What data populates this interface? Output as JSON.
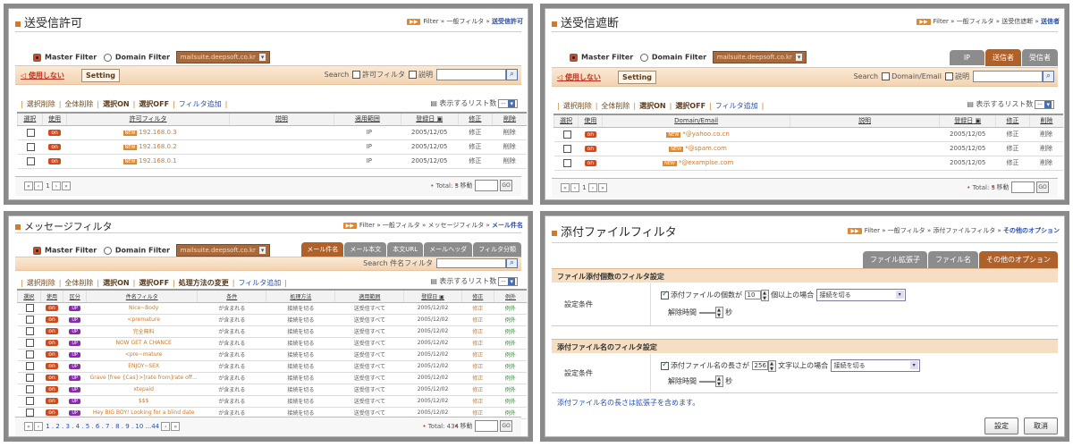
{
  "p1": {
    "title": "送受信許可",
    "crumb": {
      "badge": "Filter",
      "a": "Filter",
      "b": "一般フィルタ",
      "cur": "送受信許可"
    },
    "master": "Master Filter",
    "domain": "Domain Filter",
    "domain_value": "mailsuite.deepsoft.co.kr",
    "use": "使用しない",
    "setting": "Setting",
    "search": "Search",
    "search_cb1": "許可フィルタ",
    "search_cb2": "説明",
    "act": {
      "a": "選択削除",
      "b": "全体削除",
      "c": "選択ON",
      "d": "選択OFF",
      "e": "フィルタ追加"
    },
    "listcnt": "表示するリスト数",
    "listsel": "--",
    "cols": [
      "選択",
      "使用",
      "許可フィルタ",
      "説明",
      "適用範囲",
      "登録日",
      "修正",
      "削除"
    ],
    "rows": [
      {
        "on": "on",
        "new": "NEW",
        "val": "192.168.0.3",
        "desc": "",
        "scope": "IP",
        "date": "2005/12/05",
        "edit": "修正",
        "del": "削除"
      },
      {
        "on": "on",
        "new": "NEW",
        "val": "192.168.0.2",
        "desc": "",
        "scope": "IP",
        "date": "2005/12/05",
        "edit": "修正",
        "del": "削除"
      },
      {
        "on": "on",
        "new": "NEW",
        "val": "192.168.0.1",
        "desc": "",
        "scope": "IP",
        "date": "2005/12/05",
        "edit": "修正",
        "del": "削除"
      }
    ],
    "page": "1",
    "total": "Total: 3",
    "move": "移動",
    "go": "GO"
  },
  "p2": {
    "title": "送受信遮断",
    "crumb": {
      "badge": "Filter",
      "a": "Filter",
      "b": "一般フィルタ",
      "c": "送受信遮断",
      "cur": "送信者"
    },
    "master": "Master Filter",
    "domain": "Domain Filter",
    "domain_value": "mailsuite.deepsoft.co.kr",
    "tabs": [
      "IP",
      "送信者",
      "受信者"
    ],
    "use": "使用しない",
    "setting": "Setting",
    "search": "Search",
    "search_cb1": "Domain/Email",
    "search_cb2": "説明",
    "act": {
      "a": "選択削除",
      "b": "全体削除",
      "c": "選択ON",
      "d": "選択OFF",
      "e": "フィルタ追加"
    },
    "listcnt": "表示するリスト数",
    "listsel": "--",
    "cols": [
      "選択",
      "使用",
      "Domain/Email",
      "説明",
      "登録日",
      "修正",
      "削除"
    ],
    "rows": [
      {
        "on": "on",
        "new": "NEW",
        "val": "*@yahoo.co.cn",
        "date": "2005/12/05",
        "edit": "修正",
        "del": "削除"
      },
      {
        "on": "on",
        "new": "NEW",
        "val": "*@spam.com",
        "date": "2005/12/05",
        "edit": "修正",
        "del": "削除"
      },
      {
        "on": "on",
        "new": "NEW",
        "val": "*@examplse.com",
        "date": "2005/12/05",
        "edit": "修正",
        "del": "削除"
      }
    ],
    "page": "1",
    "total": "Total: 3",
    "move": "移動",
    "go": "GO"
  },
  "p3": {
    "title": "メッセージフィルタ",
    "crumb": {
      "badge": "Filter",
      "a": "Filter",
      "b": "一般フィルタ",
      "c": "メッセージフィルタ",
      "cur": "メール件名"
    },
    "master": "Master Filter",
    "domain": "Domain Filter",
    "domain_value": "mailsuite.deepsoft.co.kr",
    "tabs": [
      "メール件名",
      "メール本文",
      "本文URL",
      "メールヘッダ",
      "フィルタ分類"
    ],
    "search": "Search",
    "search_label": "件名フィルタ",
    "act": {
      "a": "選択削除",
      "b": "全体削除",
      "c": "選択ON",
      "d": "選択OFF",
      "e": "処理方法の変更",
      "f": "フィルタ追加"
    },
    "listcnt": "表示するリスト数",
    "listsel": "--",
    "cols": [
      "選択",
      "使用",
      "区分",
      "件名フィルタ",
      "条件",
      "処理方法",
      "適用範囲",
      "登録日",
      "修正",
      "例外"
    ],
    "rows": [
      {
        "val": "Nice~Body"
      },
      {
        "val": "<premature"
      },
      {
        "val": "完全無料"
      },
      {
        "val": "NOW GET A CHANCE"
      },
      {
        "val": "<pre~mature"
      },
      {
        "val": "ENJOY~SEX"
      },
      {
        "val": "Grave [free {Cas}>]rate from]rate off..."
      },
      {
        "val": "xtepaid"
      },
      {
        "val": "$$$"
      },
      {
        "val": "Hey BIG BOY! Looking for a blind date"
      }
    ],
    "row_common": {
      "on": "on",
      "up": "UP",
      "cond": "が含まれる",
      "method": "接続を切る",
      "scope": "送受信すべて",
      "date": "2005/12/02",
      "edit": "修正",
      "exc": "例外"
    },
    "pages": "1 . 2 . 3 . 4 . 5 . 6 . 7 . 8 . 9 . 10 ...44",
    "total": "Total: 434",
    "move": "移動",
    "go": "GO"
  },
  "p4": {
    "title": "添付ファイルフィルタ",
    "crumb": {
      "badge": "Filter",
      "a": "Filter",
      "b": "一般フィルタ",
      "c": "添付ファイルフィルタ",
      "cur": "その他のオプション"
    },
    "tabs": [
      "ファイル拡張子",
      "ファイル名",
      "その他のオプション"
    ],
    "s1": {
      "head": "ファイル添付個数のフィルタ設定",
      "label": "設定条件",
      "cb": "添付ファイルの個数が",
      "num": "10",
      "after": "個以上の場合",
      "action": "接続を切る",
      "rel": "解除時間",
      "unit": "秒"
    },
    "s2": {
      "head": "添付ファイル名のフィルタ設定",
      "label": "設定条件",
      "cb": "添付ファイル名の長さが",
      "num": "256",
      "after": "文字以上の場合",
      "action": "接続を切る",
      "rel": "解除時間",
      "unit": "秒"
    },
    "note": "添付ファイル名の長さは拡張子を含めます。",
    "ok": "設定",
    "cancel": "取消"
  }
}
